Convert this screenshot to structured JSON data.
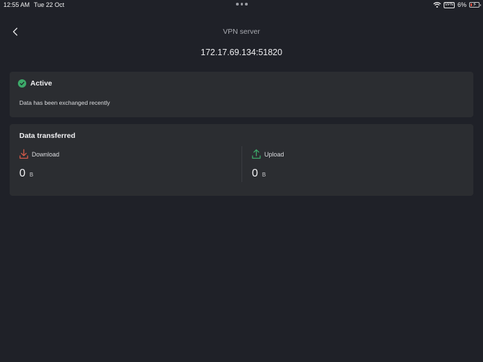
{
  "status_bar": {
    "time": "12:55 AM",
    "date": "Tue 22 Oct",
    "vpn": "VPN",
    "battery": "6%"
  },
  "nav": {
    "title": "VPN server"
  },
  "server": {
    "address": "172.17.69.134:51820"
  },
  "status_card": {
    "label": "Active",
    "description": "Data has been exchanged recently"
  },
  "data_card": {
    "title": "Data transferred",
    "download": {
      "label": "Download",
      "value": "0",
      "unit": "B"
    },
    "upload": {
      "label": "Upload",
      "value": "0",
      "unit": "B"
    }
  },
  "colors": {
    "background": "#1f2128",
    "card": "#2b2d31",
    "active_green": "#3daa6a",
    "download_red": "#d95b4a",
    "upload_green": "#3daa6a"
  },
  "icons": [
    "wifi-icon",
    "back-chevron-icon",
    "check-circle-icon",
    "download-icon",
    "upload-icon",
    "battery-icon"
  ]
}
